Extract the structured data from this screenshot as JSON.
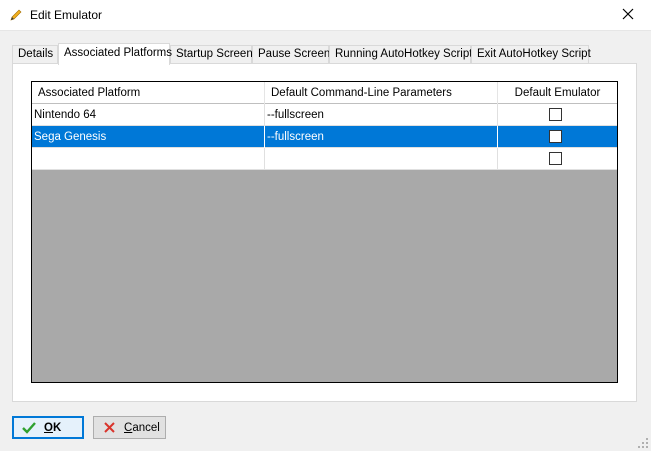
{
  "window": {
    "title": "Edit Emulator",
    "icon": "pencil-icon",
    "close_icon": "close-icon"
  },
  "tabs": [
    {
      "label": "Details",
      "active": false
    },
    {
      "label": "Associated Platforms",
      "active": true
    },
    {
      "label": "Startup Screen",
      "active": false
    },
    {
      "label": "Pause Screen",
      "active": false
    },
    {
      "label": "Running AutoHotkey Script",
      "active": false
    },
    {
      "label": "Exit AutoHotkey Script",
      "active": false
    }
  ],
  "grid": {
    "columns": [
      "Associated Platform",
      "Default Command-Line Parameters",
      "Default Emulator"
    ],
    "rows": [
      {
        "platform": "Nintendo 64",
        "params": "--fullscreen",
        "default": false,
        "selected": false
      },
      {
        "platform": "Sega Genesis",
        "params": "--fullscreen",
        "default": false,
        "selected": true
      },
      {
        "platform": "",
        "params": "",
        "default": false,
        "selected": false
      }
    ]
  },
  "buttons": {
    "ok_label": "OK",
    "ok_mnemonic": "O",
    "ok_rest": "K",
    "cancel_label": "Cancel",
    "cancel_mnemonic": "C",
    "cancel_rest": "ancel",
    "ok_icon": "checkmark-icon",
    "cancel_icon": "x-icon"
  },
  "colors": {
    "selection": "#0078d7",
    "ok_check": "#2fa12f",
    "cancel_x": "#d9342b",
    "grid_empty": "#a9a9a9"
  }
}
